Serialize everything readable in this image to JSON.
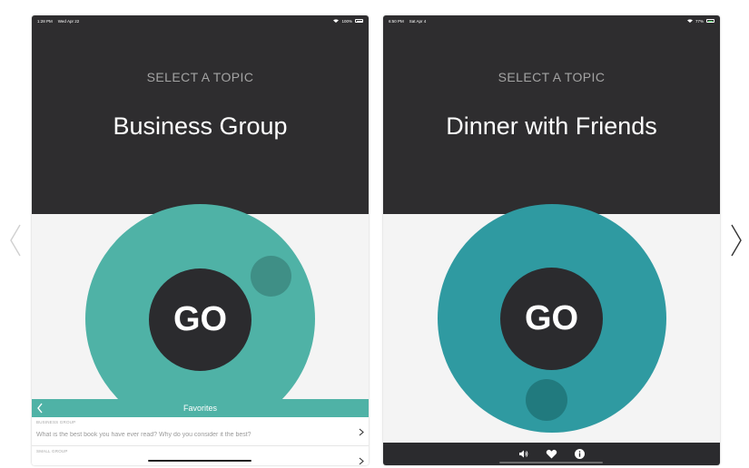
{
  "screen1": {
    "status": {
      "time": "1:28 PM",
      "date": "Wed Apr 22",
      "battery": "100%"
    },
    "select_label": "SELECT A TOPIC",
    "topic": "Business Group",
    "go_label": "GO",
    "favorites_title": "Favorites",
    "favorites": [
      {
        "category": "BUSINESS GROUP",
        "text": "What is the best book you have ever read? Why do you consider it the best?"
      },
      {
        "category": "SMALL GROUP",
        "text": ""
      }
    ]
  },
  "screen2": {
    "status": {
      "time": "6:50 PM",
      "date": "Sat Apr 4",
      "battery": "77%"
    },
    "select_label": "SELECT A TOPIC",
    "topic": "Dinner with Friends",
    "go_label": "GO",
    "toolbar_icons": [
      "speaker-icon",
      "heart-icon",
      "info-icon"
    ]
  },
  "colors": {
    "dark": "#2e2d2f",
    "teal_business": "#4fb2a6",
    "teal_dinner": "#2f9aa1",
    "go_circle": "#2b2b2e"
  }
}
